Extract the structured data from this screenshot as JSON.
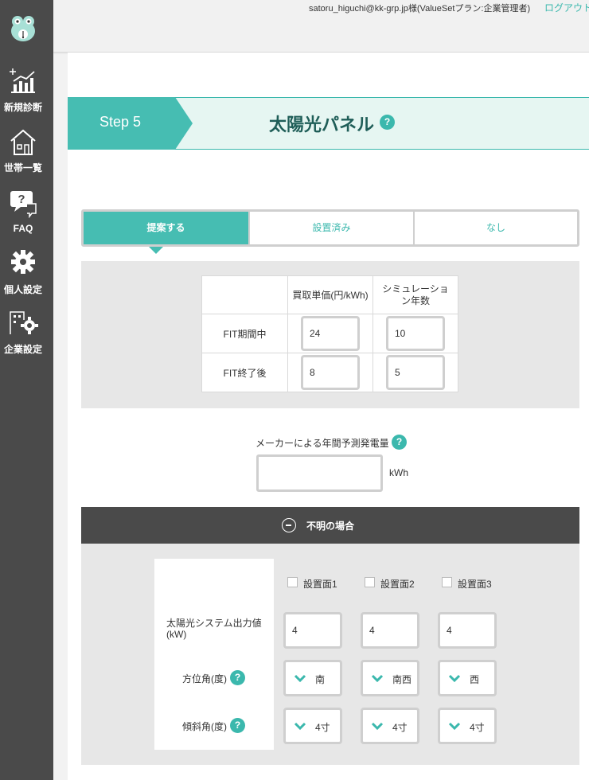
{
  "sidebar": {
    "items": [
      {
        "label": "新規診断",
        "icon": "chart-plus-icon"
      },
      {
        "label": "世帯一覧",
        "icon": "house-icon"
      },
      {
        "label": "FAQ",
        "icon": "chat-question-icon"
      },
      {
        "label": "個人設定",
        "icon": "gear-icon"
      },
      {
        "label": "企業設定",
        "icon": "building-gear-icon"
      }
    ]
  },
  "header": {
    "user": "satoru_higuchi@kk-grp.jp様(ValueSetプラン:企業管理者)",
    "logout": "ログアウト"
  },
  "step": {
    "label": "Step 5",
    "title": "太陽光パネル",
    "help": "?"
  },
  "tabs": [
    "提案する",
    "設置済み",
    "なし"
  ],
  "fit_table": {
    "headers": [
      "",
      "買取単価(円/kWh)",
      "シミュレーション年数"
    ],
    "rows": [
      {
        "label": "FIT期間中",
        "price": "24",
        "years": "10"
      },
      {
        "label": "FIT終了後",
        "price": "8",
        "years": "5"
      }
    ]
  },
  "generation": {
    "label": "メーカーによる年間予測発電量",
    "value": "",
    "unit": "kWh"
  },
  "unknown_section": {
    "label": "不明の場合"
  },
  "surfaces": {
    "checkboxes": [
      "設置面1",
      "設置面2",
      "設置面3"
    ],
    "output_label": "太陽光システム出力値(kW)",
    "outputs": [
      "4",
      "4",
      "4"
    ],
    "azimuth_label": "方位角(度)",
    "azimuths": [
      "南",
      "南西",
      "西"
    ],
    "tilt_label": "傾斜角(度)",
    "tilts": [
      "4寸",
      "4寸",
      "4寸"
    ]
  },
  "colors": {
    "accent": "#46bdb2",
    "sidebar": "#4a4a4a",
    "title": "#1f5e58"
  }
}
